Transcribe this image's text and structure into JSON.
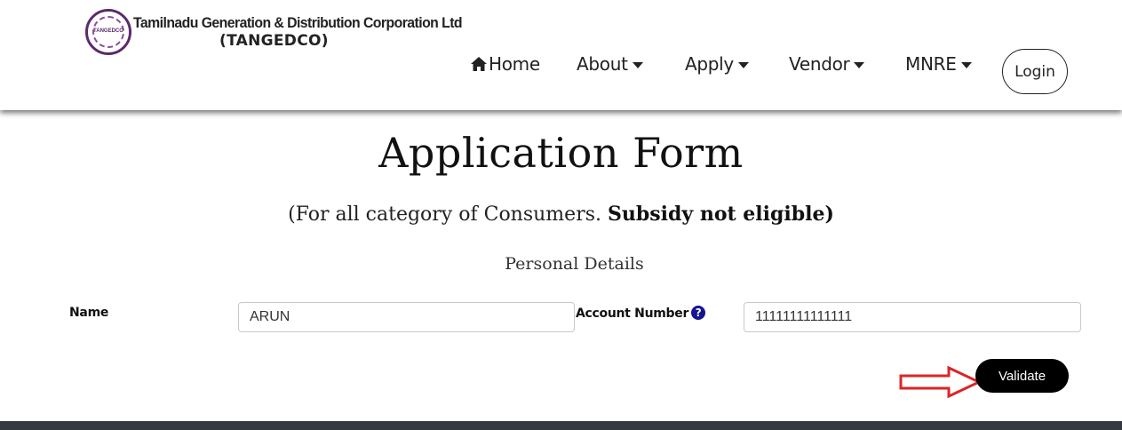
{
  "header": {
    "logo_text": "TANGEDCO",
    "brand_name": "Tamilnadu Generation & Distribution Corporation Ltd",
    "brand_sub": "(TANGEDCO)"
  },
  "nav": {
    "home": "Home",
    "about": "About",
    "apply": "Apply",
    "vendor": "Vendor",
    "mnre": "MNRE",
    "login": "Login"
  },
  "page": {
    "title": "Application Form",
    "subtitle_prefix": "(For all category of Consumers. ",
    "subtitle_bold": "Subsidy not eligible)",
    "section": "Personal Details"
  },
  "form": {
    "name_label": "Name",
    "name_value": "ARUN",
    "account_label": "Account Number",
    "account_value": "11111111111111",
    "help": "?",
    "validate": "Validate"
  },
  "colors": {
    "accent": "#000000",
    "help_icon": "#15158f",
    "arrow": "#d9262b",
    "footer": "#343a40"
  }
}
